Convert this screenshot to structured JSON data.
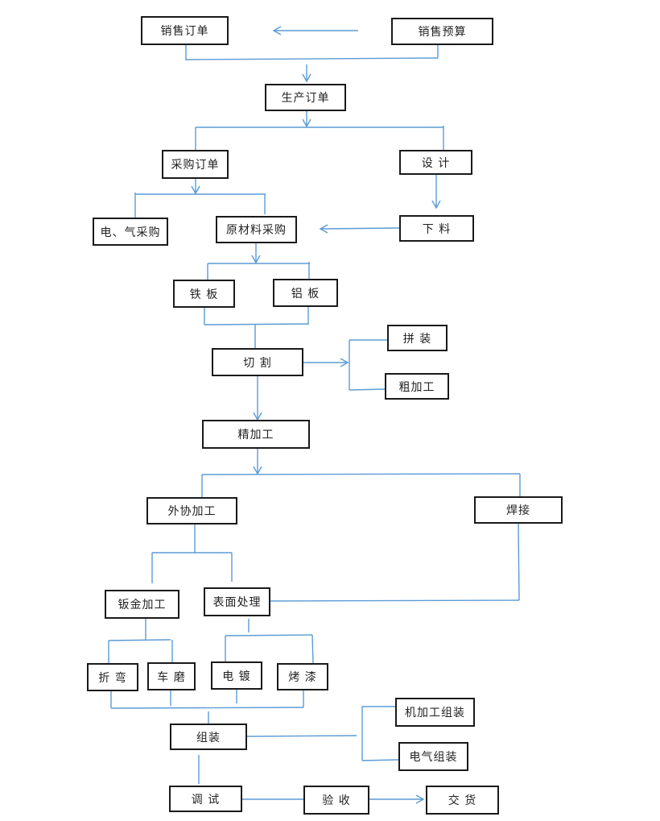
{
  "diagram": {
    "type": "flowchart",
    "line_color": "#5b9bd5",
    "box_border_color": "#1a1a1a",
    "nodes": [
      {
        "id": "sales-order",
        "label": "销售订单"
      },
      {
        "id": "sales-budget",
        "label": "销售预算"
      },
      {
        "id": "production-order",
        "label": "生产订单"
      },
      {
        "id": "purchase-order",
        "label": "采购订单"
      },
      {
        "id": "design",
        "label": "设  计"
      },
      {
        "id": "electric-gas-purchase",
        "label": "电、气采购"
      },
      {
        "id": "raw-material-purchase",
        "label": "原材料采购"
      },
      {
        "id": "blanking",
        "label": "下  料"
      },
      {
        "id": "iron-plate",
        "label": "铁  板"
      },
      {
        "id": "aluminum-plate",
        "label": "铝  板"
      },
      {
        "id": "cutting",
        "label": "切    割"
      },
      {
        "id": "assembly-splice",
        "label": "拼  装"
      },
      {
        "id": "rough-machining",
        "label": "粗加工"
      },
      {
        "id": "finish-machining",
        "label": "精加工"
      },
      {
        "id": "outsourced-processing",
        "label": "外协加工"
      },
      {
        "id": "welding",
        "label": "焊接"
      },
      {
        "id": "sheet-metal",
        "label": "钣金加工"
      },
      {
        "id": "surface-treatment",
        "label": "表面处理"
      },
      {
        "id": "bending",
        "label": "折  弯"
      },
      {
        "id": "turning-grinding",
        "label": "车  磨"
      },
      {
        "id": "electroplating",
        "label": "电  镀"
      },
      {
        "id": "painting",
        "label": "烤  漆"
      },
      {
        "id": "assembly",
        "label": "组装"
      },
      {
        "id": "machining-assembly",
        "label": "机加工组装"
      },
      {
        "id": "electrical-assembly",
        "label": "电气组装"
      },
      {
        "id": "debugging",
        "label": "调  试"
      },
      {
        "id": "acceptance",
        "label": "验  收"
      },
      {
        "id": "delivery",
        "label": "交  货"
      }
    ],
    "edges": [
      {
        "from": "sales-budget",
        "to": "sales-order",
        "arrow": true
      },
      {
        "from": "sales-order",
        "to": "production-order",
        "arrow": true
      },
      {
        "from": "sales-budget",
        "to": "production-order",
        "arrow": true
      },
      {
        "from": "production-order",
        "to": "purchase-order",
        "arrow": false
      },
      {
        "from": "production-order",
        "to": "design",
        "arrow": false
      },
      {
        "from": "purchase-order",
        "to": "electric-gas-purchase",
        "arrow": false
      },
      {
        "from": "purchase-order",
        "to": "raw-material-purchase",
        "arrow": false
      },
      {
        "from": "design",
        "to": "blanking",
        "arrow": true
      },
      {
        "from": "blanking",
        "to": "raw-material-purchase",
        "arrow": true
      },
      {
        "from": "raw-material-purchase",
        "to": "iron-plate",
        "arrow": false
      },
      {
        "from": "raw-material-purchase",
        "to": "aluminum-plate",
        "arrow": false
      },
      {
        "from": "iron-plate",
        "to": "cutting",
        "arrow": false
      },
      {
        "from": "aluminum-plate",
        "to": "cutting",
        "arrow": false
      },
      {
        "from": "cutting",
        "to": "assembly-splice",
        "arrow": true
      },
      {
        "from": "cutting",
        "to": "rough-machining",
        "arrow": true
      },
      {
        "from": "cutting",
        "to": "finish-machining",
        "arrow": true
      },
      {
        "from": "finish-machining",
        "to": "outsourced-processing",
        "arrow": false
      },
      {
        "from": "finish-machining",
        "to": "welding",
        "arrow": false
      },
      {
        "from": "outsourced-processing",
        "to": "sheet-metal",
        "arrow": false
      },
      {
        "from": "outsourced-processing",
        "to": "surface-treatment",
        "arrow": false
      },
      {
        "from": "welding",
        "to": "surface-treatment",
        "arrow": false
      },
      {
        "from": "sheet-metal",
        "to": "bending",
        "arrow": false
      },
      {
        "from": "sheet-metal",
        "to": "turning-grinding",
        "arrow": false
      },
      {
        "from": "surface-treatment",
        "to": "electroplating",
        "arrow": false
      },
      {
        "from": "surface-treatment",
        "to": "painting",
        "arrow": false
      },
      {
        "from": "bending",
        "to": "assembly",
        "arrow": false
      },
      {
        "from": "turning-grinding",
        "to": "assembly",
        "arrow": false
      },
      {
        "from": "electroplating",
        "to": "assembly",
        "arrow": false
      },
      {
        "from": "painting",
        "to": "assembly",
        "arrow": false
      },
      {
        "from": "assembly",
        "to": "machining-assembly",
        "arrow": false
      },
      {
        "from": "assembly",
        "to": "electrical-assembly",
        "arrow": false
      },
      {
        "from": "assembly",
        "to": "debugging",
        "arrow": false
      },
      {
        "from": "debugging",
        "to": "acceptance",
        "arrow": false
      },
      {
        "from": "acceptance",
        "to": "delivery",
        "arrow": true
      }
    ]
  }
}
